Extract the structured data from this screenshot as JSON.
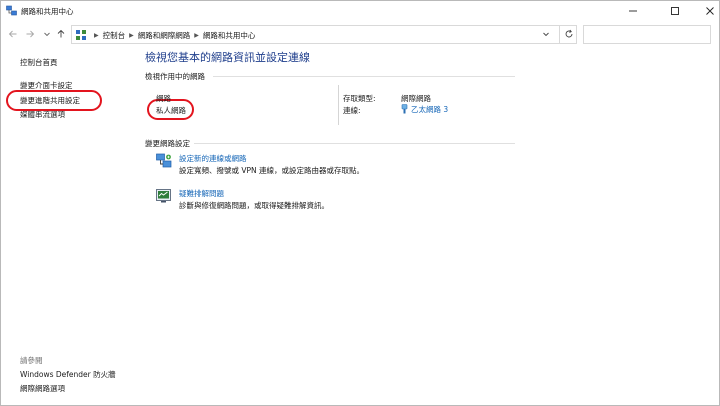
{
  "window": {
    "title": "網路和共用中心",
    "minimize_icon": "minimize-icon",
    "maximize_icon": "maximize-icon",
    "close_icon": "close-icon"
  },
  "nav": {
    "back_icon": "arrow-left-icon",
    "forward_icon": "arrow-right-icon",
    "recent_icon": "chevron-down-icon",
    "up_icon": "arrow-up-icon",
    "breadcrumbs": [
      "控制台",
      "網路和網際網路",
      "網路和共用中心"
    ],
    "search_placeholder": ""
  },
  "sidebar": {
    "home": "控制台首頁",
    "links": [
      "變更介面卡設定",
      "變更進階共用設定",
      "媒體串流選項"
    ],
    "see_also_label": "請參閱",
    "see_also": [
      "Windows Defender 防火牆",
      "網際網路選項"
    ]
  },
  "main": {
    "title": "檢視您基本的網路資訊並設定連線",
    "active_networks_header": "檢視作用中的網路",
    "network_name_label": "網路",
    "network_profile": "私人網路",
    "access_type_label": "存取類型:",
    "access_type_value": "網際網路",
    "connections_label": "連線:",
    "connection_value": "乙太網路 3",
    "change_settings_header": "變更網路設定",
    "tasks": [
      {
        "icon": "network-setup-icon",
        "link": "設定新的連線或網路",
        "desc": "設定寬頻、撥號或 VPN 連線，或設定路由器或存取點。"
      },
      {
        "icon": "troubleshoot-icon",
        "link": "疑難排解問題",
        "desc": "診斷與修復網路問題，或取得疑難排解資訊。"
      }
    ]
  },
  "annotation": {
    "color": "#e3141e"
  }
}
